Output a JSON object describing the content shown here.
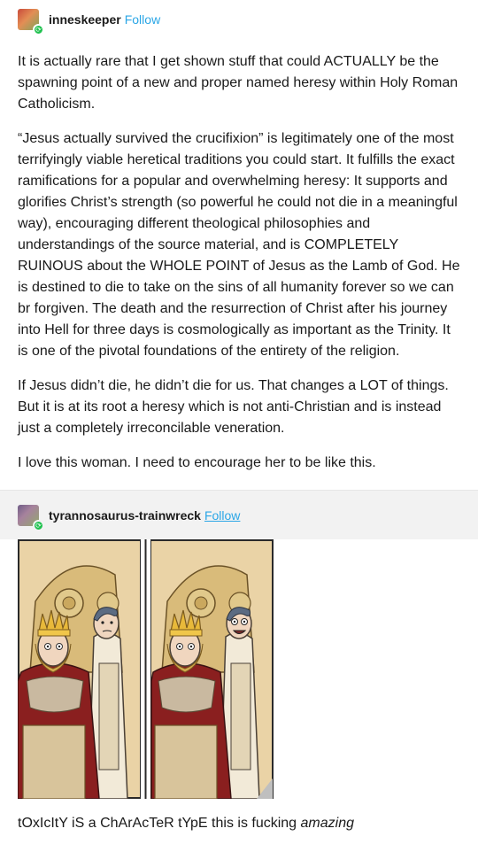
{
  "post1": {
    "username": "inneskeeper",
    "follow_label": "Follow",
    "paragraphs": [
      "It is actually rare that I get shown stuff that could ACTUALLY be the spawning point of a new and proper named heresy within Holy Roman Catholicism.",
      "“Jesus actually survived the crucifixion” is legitimately one of the most terrifyingly viable heretical traditions you could start. It fulfills the exact ramifications for a popular and overwhelming heresy: It supports and glorifies Christ’s strength (so powerful he could not die in a meaningful way), encouraging different theological philosophies and understandings of the source material, and is COMPLETELY RUINOUS about the WHOLE POINT of Jesus as the Lamb of God. He is destined to die to take on the sins of all humanity forever so we can br forgiven. The death and the resurrection of Christ after his journey into Hell for three days is cosmologically as important as the Trinity. It is one of the pivotal foundations of the entirety of the religion.",
      "If Jesus didn’t die, he didn’t die for us. That changes a LOT of things. But it is at its root a heresy which is not anti-Christian and is instead just a completely irreconcilable veneration.",
      "I love this woman. I need to encourage her to be like this."
    ]
  },
  "post2": {
    "username": "tyrannosaurus-trainwreck",
    "follow_label": "Follow",
    "caption_plain": "tOxIcItY iS a ChArAcTeR tYpE this is fucking ",
    "caption_emph": "amazing"
  },
  "colors": {
    "follow": "#2aa6e6",
    "reblog_header_bg": "#f2f2f2",
    "badge": "#1fc14e",
    "comic_bg": "#e7ceA0"
  },
  "icons": {
    "reblog_badge": "reblog-icon"
  }
}
